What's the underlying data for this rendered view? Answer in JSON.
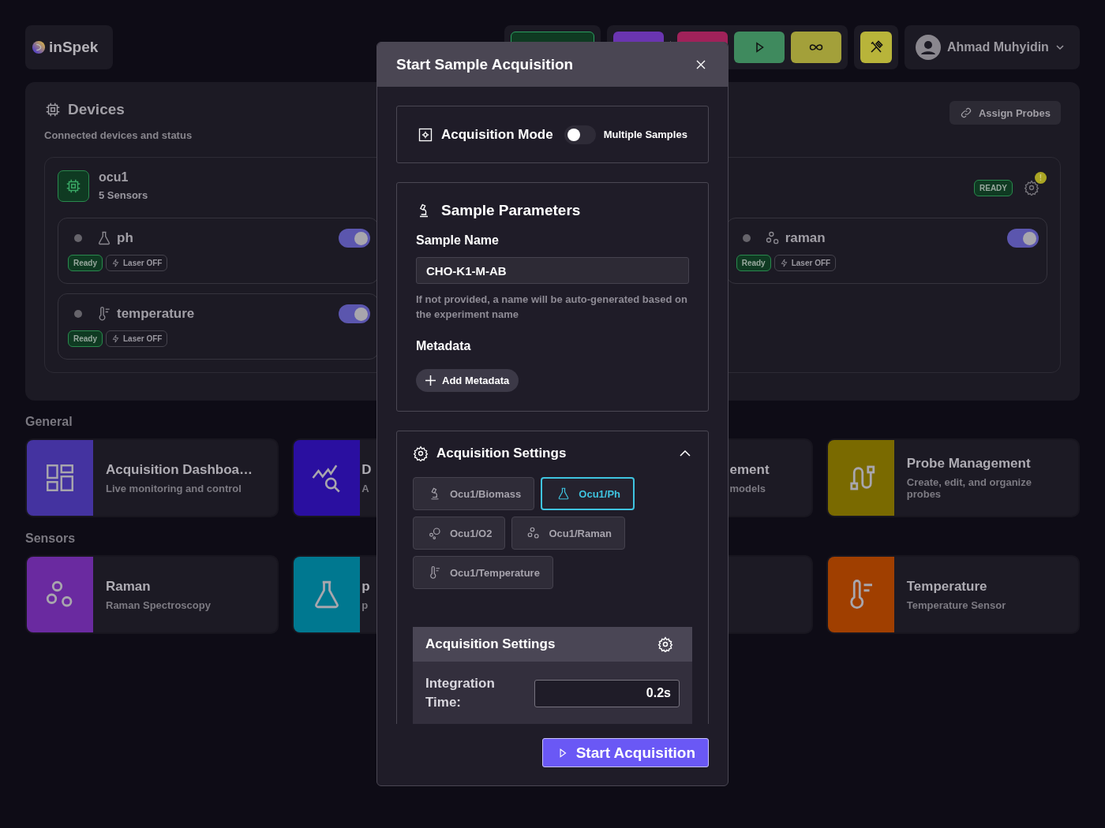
{
  "logo": {
    "text": "inSpek"
  },
  "toolbar": [
    {
      "buttons": [
        {
          "kind": "blank",
          "color": "#0f3a22"
        }
      ]
    },
    {
      "buttons": [
        {
          "kind": "blank",
          "color": "#6a35b0"
        },
        {
          "kind": "blank",
          "color": "#a0225a"
        },
        {
          "kind": "play",
          "color": "#3f8a5e"
        },
        {
          "kind": "loop",
          "color": "#a3a03a"
        }
      ]
    },
    {
      "buttons": [
        {
          "kind": "tools",
          "color": "#b8b43a"
        }
      ]
    }
  ],
  "user": {
    "name": "Ahmad Muhyidin"
  },
  "devices": {
    "title": "Devices",
    "subtitle": "Connected devices and status",
    "action": "Assign Probes",
    "device": {
      "name": "ocu1",
      "sensor_count": "5 Sensors",
      "status": "READY",
      "alert": "!",
      "sensors": [
        {
          "name": "ph",
          "kind": "flask",
          "status": "Ready",
          "laser": "Laser OFF",
          "on": true
        },
        {
          "name": "raman",
          "kind": "circles",
          "status": "Ready",
          "laser": "Laser OFF",
          "on": true
        },
        {
          "name": "temperature",
          "kind": "thermometer",
          "status": "Ready",
          "laser": "Laser OFF",
          "on": true
        }
      ]
    }
  },
  "sections": [
    {
      "title": "General",
      "cards": [
        {
          "title": "Acquisition Dashboa…",
          "subtitle": "Live monitoring and control",
          "kind": "dashboard",
          "color": "#4433a0"
        },
        {
          "title": "D",
          "subtitle": "A",
          "kind": "chart",
          "color": "#2a0fa0"
        },
        {
          "title": "ement",
          "subtitle": "models",
          "kind": "cut"
        },
        {
          "title": "Probe Management",
          "subtitle": "Create, edit, and organize probes",
          "kind": "probe",
          "color": "#7a6a00"
        }
      ]
    },
    {
      "title": "Sensors",
      "cards": [
        {
          "title": "Raman",
          "subtitle": "Raman Spectroscopy",
          "kind": "circles",
          "color": "#6a2aa0"
        },
        {
          "title": "p",
          "subtitle": "p",
          "kind": "flask",
          "color": "#007890"
        },
        {
          "kind": "blank"
        },
        {
          "title": "Temperature",
          "subtitle": "Temperature Sensor",
          "kind": "thermometer",
          "color": "#a03f00"
        }
      ]
    }
  ],
  "modal": {
    "title": "Start Sample Acquisition",
    "mode": {
      "label": "Acquisition Mode",
      "on": false,
      "option": "Multiple Samples"
    },
    "sample": {
      "title": "Sample Parameters",
      "name_label": "Sample Name",
      "name_value": "CHO-K1-M-AB",
      "hint": "If not provided, a name will be auto-generated based on the experiment name",
      "metadata_label": "Metadata",
      "add_button": "Add Metadata"
    },
    "settings": {
      "title": "Acquisition Settings",
      "expanded": true,
      "probes": [
        {
          "label": "Ocu1/Biomass",
          "kind": "microscope",
          "selected": false
        },
        {
          "label": "Ocu1/Ph",
          "kind": "flask",
          "selected": true
        },
        {
          "label": "Ocu1/O2",
          "kind": "bubbles",
          "selected": false
        },
        {
          "label": "Ocu1/Raman",
          "kind": "circles",
          "selected": false
        },
        {
          "label": "Ocu1/Temperature",
          "kind": "thermometer",
          "selected": false
        }
      ],
      "panel": {
        "title": "Acquisition Settings",
        "fields": [
          {
            "label": "Integration Time:",
            "value": "0.2s"
          }
        ]
      }
    },
    "submit": "Start Acquisition"
  }
}
